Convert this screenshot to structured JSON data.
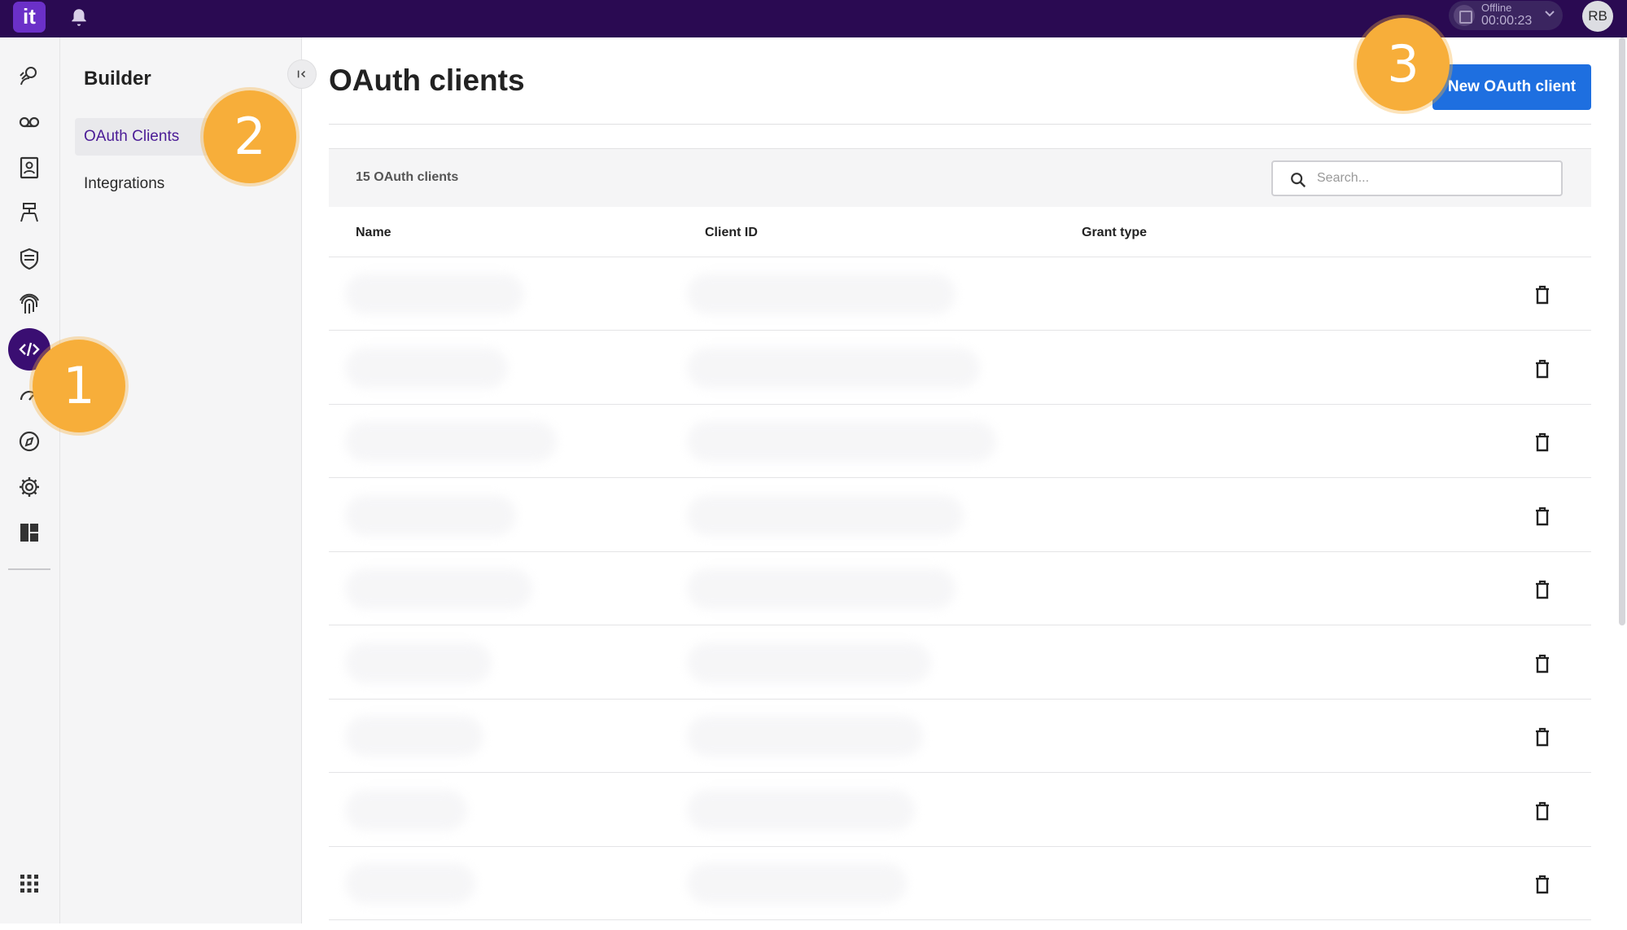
{
  "topbar": {
    "logo_text": "it",
    "status_label": "Offline",
    "status_time": "00:00:23",
    "avatar_initials": "RB"
  },
  "rail": {
    "icons": [
      "agent-icon",
      "voicemail-icon",
      "contacts-icon",
      "flows-icon",
      "shield-icon",
      "fingerprint-icon",
      "code-icon",
      "analytics-icon",
      "compass-icon",
      "settings-icon",
      "layout-icon",
      "apps-grid-icon"
    ],
    "active_icon": "code-icon"
  },
  "subnav": {
    "title": "Builder",
    "items": [
      {
        "label": "OAuth Clients",
        "active": true
      },
      {
        "label": "Integrations",
        "active": false
      }
    ]
  },
  "main": {
    "title": "OAuth clients",
    "new_button_label": "New OAuth client",
    "count_label": "15 OAuth clients",
    "search_placeholder": "Search...",
    "columns": [
      "Name",
      "Client ID",
      "Grant type"
    ],
    "row_count_visible": 9
  },
  "callouts": [
    "1",
    "2",
    "3"
  ],
  "colors": {
    "topbar": "#2a0a52",
    "accent_purple": "#3a0e72",
    "primary_blue": "#1e6fe0",
    "callout_orange": "#f7ae3a"
  }
}
